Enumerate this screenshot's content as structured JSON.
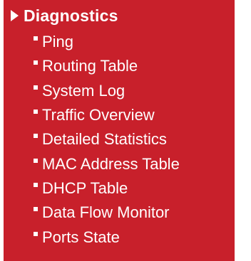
{
  "menu": {
    "title": "Diagnostics",
    "items": [
      {
        "label": "Ping"
      },
      {
        "label": "Routing Table"
      },
      {
        "label": "System Log"
      },
      {
        "label": "Traffic Overview"
      },
      {
        "label": "Detailed Statistics"
      },
      {
        "label": "MAC Address Table"
      },
      {
        "label": "DHCP Table"
      },
      {
        "label": "Data Flow Monitor"
      },
      {
        "label": "Ports State"
      }
    ]
  },
  "colors": {
    "panel_background": "#c8202b",
    "text": "#ffffff"
  },
  "icons": {
    "header": "triangle-right-icon",
    "item": "square-bullet-icon"
  }
}
